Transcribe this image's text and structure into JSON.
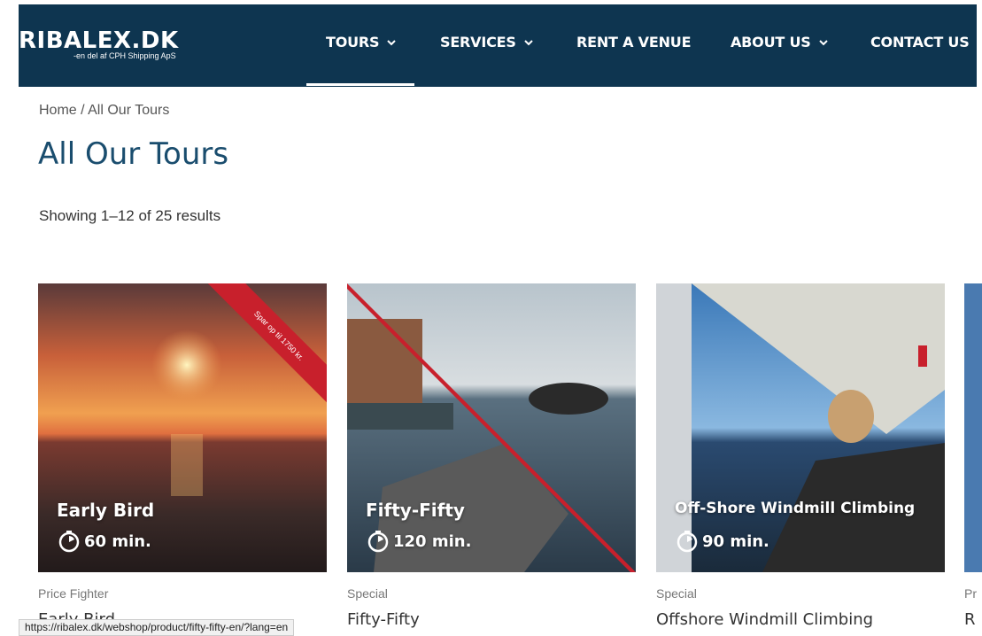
{
  "header": {
    "logo": "RIBALEX.DK",
    "logo_sub": "-en del af CPH Shipping ApS",
    "nav": [
      {
        "label": "TOURS",
        "has_dropdown": true
      },
      {
        "label": "SERVICES",
        "has_dropdown": true
      },
      {
        "label": "RENT A VENUE",
        "has_dropdown": false
      },
      {
        "label": "ABOUT US",
        "has_dropdown": true
      },
      {
        "label": "CONTACT US",
        "has_dropdown": false
      }
    ]
  },
  "breadcrumb": "Home / All Our Tours",
  "page_title": "All Our Tours",
  "results": "Showing 1–12 of 25 results",
  "cards": [
    {
      "overlay_title": "Early Bird",
      "duration": "60 min.",
      "ribbon": "Spar op til 1750 kr.",
      "category": "Price Fighter",
      "name": "Early Bird"
    },
    {
      "overlay_title": "Fifty-Fifty",
      "duration": "120 min.",
      "category": "Special",
      "name": "Fifty-Fifty"
    },
    {
      "overlay_title": "Off-Shore Windmill Climbing",
      "duration": "90 min.",
      "category": "Special",
      "name": "Offshore Windmill Climbing"
    },
    {
      "category": "Pr",
      "name": "R"
    }
  ],
  "status_url": "https://ribalex.dk/webshop/product/fifty-fifty-en/?lang=en",
  "colors": {
    "header_bg": "#0e3550",
    "title": "#1a4d6e",
    "ribbon": "#c8202c"
  }
}
